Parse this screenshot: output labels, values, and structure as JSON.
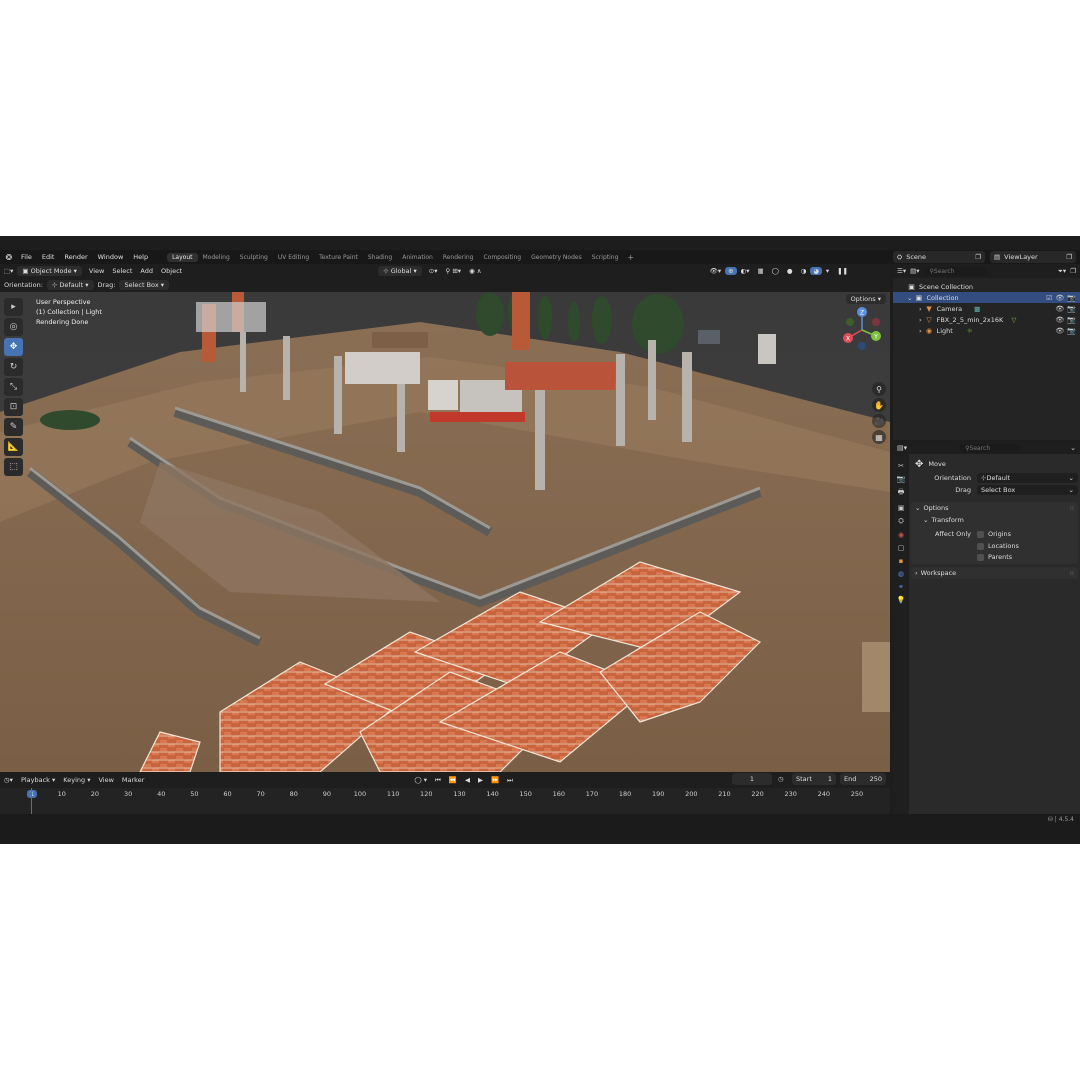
{
  "menu": [
    "File",
    "Edit",
    "Render",
    "Window",
    "Help"
  ],
  "workspaces": [
    "Layout",
    "Modeling",
    "Sculpting",
    "UV Editing",
    "Texture Paint",
    "Shading",
    "Animation",
    "Rendering",
    "Compositing",
    "Geometry Nodes",
    "Scripting"
  ],
  "active_workspace": "Layout",
  "scene_name": "Scene",
  "view_layer": "ViewLayer",
  "viewport_header": {
    "mode": "Object Mode",
    "menus": [
      "View",
      "Select",
      "Add",
      "Object"
    ],
    "transform_orientation": "Global"
  },
  "tool_header": {
    "orientation_label": "Orientation:",
    "orientation_value": "Default",
    "drag_label": "Drag:",
    "drag_value": "Select Box",
    "options": "Options"
  },
  "viewport_overlay": {
    "line1": "User Perspective",
    "line2": "(1) Collection | Light",
    "line3": "Rendering Done"
  },
  "gizmo": {
    "x": "X",
    "y": "Y",
    "z": "Z"
  },
  "timeline": {
    "menus": [
      "Playback",
      "Keying",
      "View",
      "Marker"
    ],
    "current_frame": "1",
    "start_label": "Start",
    "start": "1",
    "end_label": "End",
    "end": "250",
    "ticks": [
      "1",
      "10",
      "20",
      "30",
      "40",
      "50",
      "60",
      "70",
      "80",
      "90",
      "100",
      "110",
      "120",
      "130",
      "140",
      "150",
      "160",
      "170",
      "180",
      "190",
      "200",
      "210",
      "220",
      "230",
      "240",
      "250"
    ]
  },
  "outliner": {
    "search_placeholder": "Search",
    "scene_collection": "Scene Collection",
    "collection": "Collection",
    "items": [
      "Camera",
      "FBX_2_5_min_2x16K",
      "Light"
    ]
  },
  "properties": {
    "search_placeholder": "Search",
    "tool_name": "Move",
    "orientation_label": "Orientation",
    "orientation_value": "Default",
    "drag_label": "Drag",
    "drag_value": "Select Box",
    "options_panel": "Options",
    "transform_panel": "Transform",
    "affect_only_label": "Affect Only",
    "affect_only": [
      "Origins",
      "Locations",
      "Parents"
    ],
    "workspace_panel": "Workspace"
  },
  "version": "4.5.4",
  "colors": {
    "accent": "#4772b3",
    "header": "#1e1e1e",
    "panel": "#2a2a2a"
  }
}
